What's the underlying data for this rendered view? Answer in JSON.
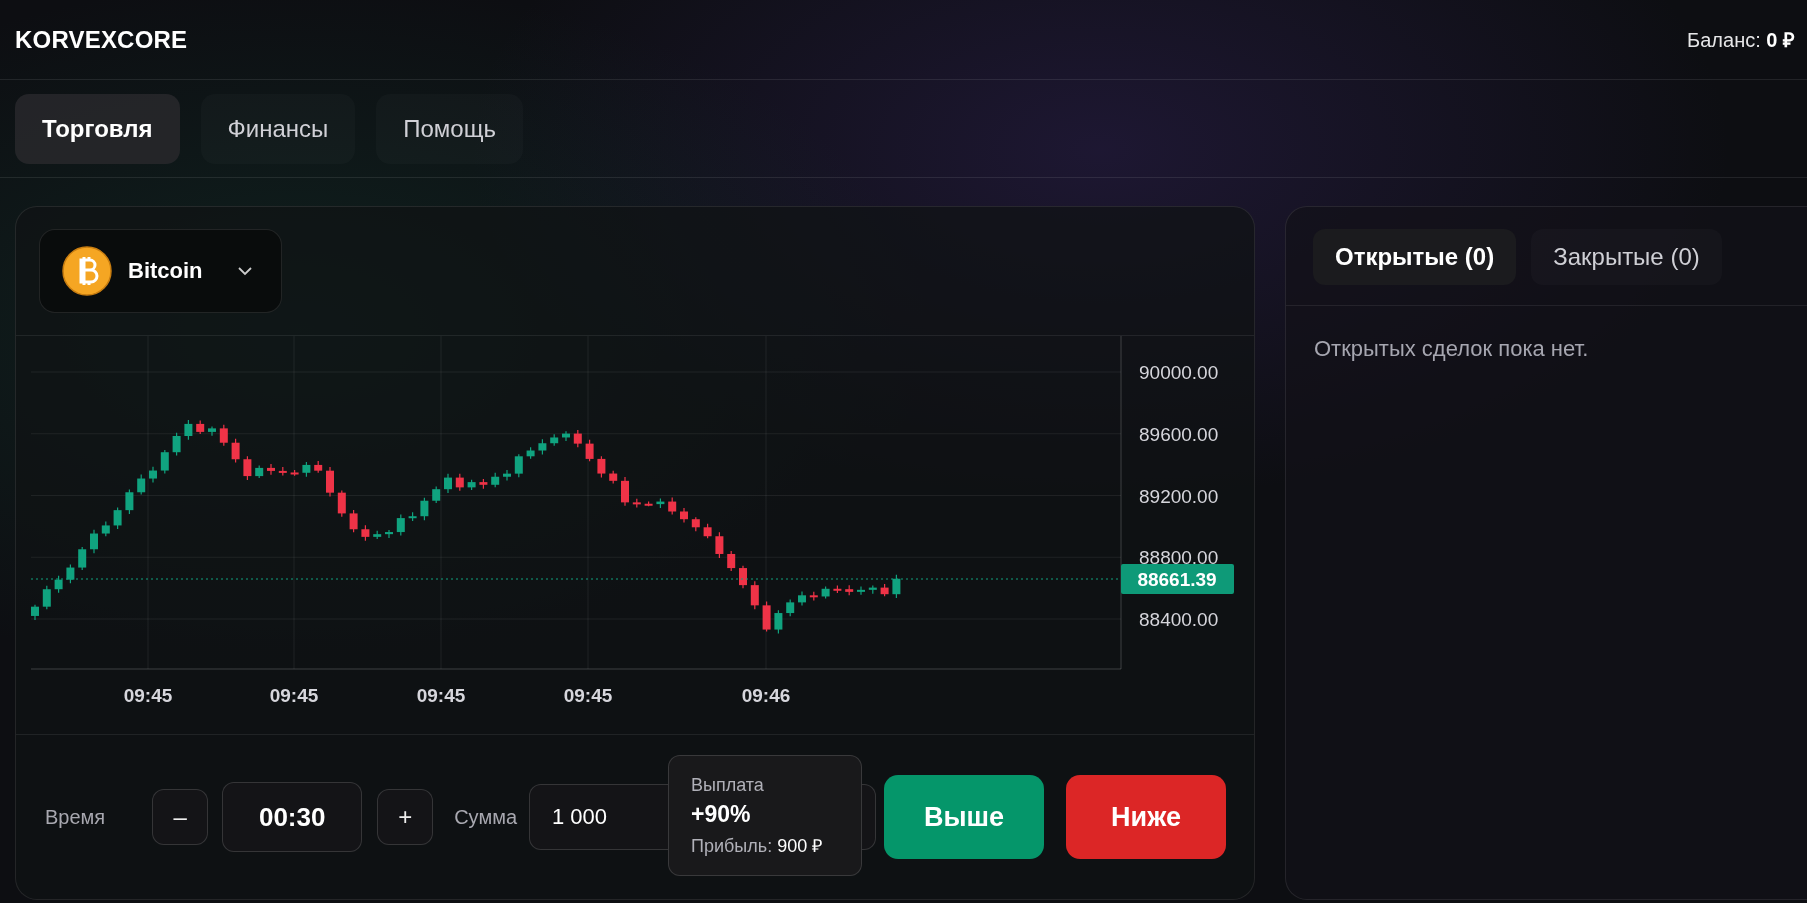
{
  "header": {
    "logo": "KORVEXCORE",
    "balance": "Баланс: **0 ₽**"
  },
  "nav_tabs": [
    {
      "label": "Торговля",
      "selected": true
    },
    {
      "label": "Финансы",
      "selected": false
    },
    {
      "label": "Помощь",
      "selected": false
    }
  ],
  "trade": {
    "asset": {
      "name": "Bitcoin"
    },
    "chart": {
      "price_ticks": [
        "90000.00",
        "89600.00",
        "89200.00",
        "88800.00",
        "88400.00"
      ],
      "time_labels": [
        "09:45",
        "09:45",
        "09:45",
        "09:45",
        "09:46"
      ],
      "current_price": "88661.39"
    },
    "controls": {
      "time_label": "Время",
      "decrement": "–",
      "time_value": "00:30",
      "increment": "+",
      "amount_label": "Сумма",
      "amount_value": "1 000",
      "payout": {
        "title": "Выплата",
        "percent": "+90%",
        "profit_label": "Прибыль:",
        "profit_value": "900 ₽"
      },
      "buttons": [
        {
          "kind": "up",
          "label": "Выше"
        },
        {
          "kind": "down",
          "label": "Ниже"
        }
      ]
    }
  },
  "deals": {
    "tabs": [
      {
        "label": "Открытые (0)",
        "selected": true
      },
      {
        "label": "Закрытые (0)",
        "selected": false
      }
    ],
    "empty_message": "Открытых сделок пока нет."
  }
}
